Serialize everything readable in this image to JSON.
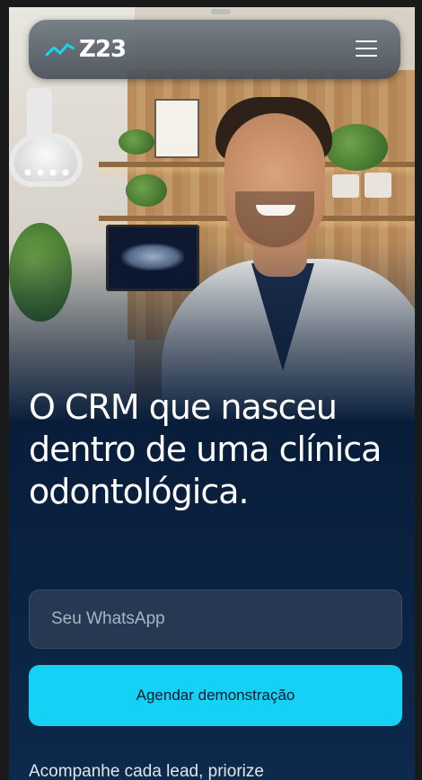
{
  "header": {
    "logo_text": "Z23",
    "logo_icon": "wave-graph-icon",
    "menu_icon": "hamburger-menu-icon"
  },
  "hero": {
    "headline": "O CRM que nasceu dentro de uma clínica odontológica.",
    "image_subject": "dentist-in-clinic"
  },
  "form": {
    "whatsapp_placeholder": "Seu WhatsApp",
    "whatsapp_value": "",
    "cta_label": "Agendar demonstração"
  },
  "subtext": "Acompanhe cada lead, priorize",
  "colors": {
    "accent": "#14d1f5",
    "background": "#081d3a",
    "input_bg": "#263852"
  }
}
